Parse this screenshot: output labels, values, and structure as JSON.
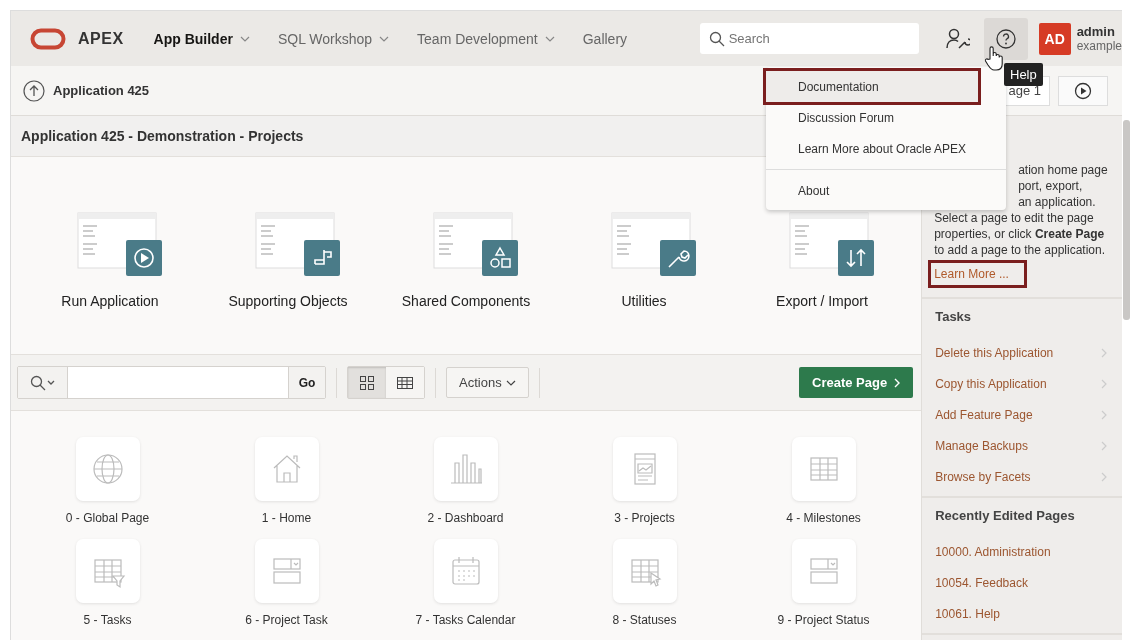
{
  "header": {
    "logo_text": "APEX",
    "nav": [
      {
        "label": "App Builder",
        "selected": true,
        "has_menu": true
      },
      {
        "label": "SQL Workshop",
        "selected": false,
        "has_menu": true
      },
      {
        "label": "Team Development",
        "selected": false,
        "has_menu": true
      },
      {
        "label": "Gallery",
        "selected": false,
        "has_menu": false
      }
    ],
    "search": {
      "placeholder": "Search"
    },
    "user": {
      "initials": "AD",
      "name": "admin",
      "workspace": "example"
    }
  },
  "help_tooltip": "Help",
  "help_menu": [
    [
      {
        "label": "Documentation",
        "highlighted": true
      },
      {
        "label": "Discussion Forum",
        "highlighted": false
      },
      {
        "label": "Learn More about Oracle APEX",
        "highlighted": false
      }
    ],
    [
      {
        "label": "About",
        "highlighted": false
      }
    ]
  ],
  "breadcrumb": {
    "label": "Application 425"
  },
  "page_field": {
    "value": "age 1"
  },
  "region_title": "Application 425 - Demonstration - Projects",
  "tools": [
    {
      "label": "Run Application"
    },
    {
      "label": "Supporting Objects"
    },
    {
      "label": "Shared Components"
    },
    {
      "label": "Utilities"
    },
    {
      "label": "Export / Import"
    }
  ],
  "toolbar": {
    "go": "Go",
    "view_modes": [
      {
        "kind": "icons",
        "selected": true
      },
      {
        "kind": "report",
        "selected": false
      }
    ],
    "actions": "Actions",
    "create": "Create Page"
  },
  "pages": [
    {
      "label": "0 - Global Page"
    },
    {
      "label": "1 - Home"
    },
    {
      "label": "2 - Dashboard"
    },
    {
      "label": "3 - Projects"
    },
    {
      "label": "4 - Milestones"
    },
    {
      "label": "5 - Tasks"
    },
    {
      "label": "6 - Project Task"
    },
    {
      "label": "7 - Tasks Calendar"
    },
    {
      "label": "8 - Statuses"
    },
    {
      "label": "9 - Project Status"
    }
  ],
  "side": {
    "help_lines": [
      {
        "text": "ation home page",
        "kind": "partial"
      },
      {
        "text": "port, export,",
        "kind": "partial"
      },
      {
        "text": "an application.",
        "kind": "partial"
      },
      {
        "text": "Select a page to edit the page",
        "kind": "full"
      },
      {
        "text": "properties, or click **Create Page**",
        "kind": "full"
      },
      {
        "text": "to add a page to the application.",
        "kind": "full"
      }
    ],
    "learn_more": {
      "label": "Learn More ...",
      "outlined": true
    },
    "tasks_title": "Tasks",
    "tasks": [
      {
        "label": "Delete this Application"
      },
      {
        "label": "Copy this Application"
      },
      {
        "label": "Add Feature Page"
      },
      {
        "label": "Manage Backups"
      },
      {
        "label": "Browse by Facets"
      }
    ],
    "recent_title": "Recently Edited Pages",
    "recent": [
      {
        "label": "10000. Administration"
      },
      {
        "label": "10054. Feedback"
      },
      {
        "label": "10061. Help"
      }
    ]
  }
}
